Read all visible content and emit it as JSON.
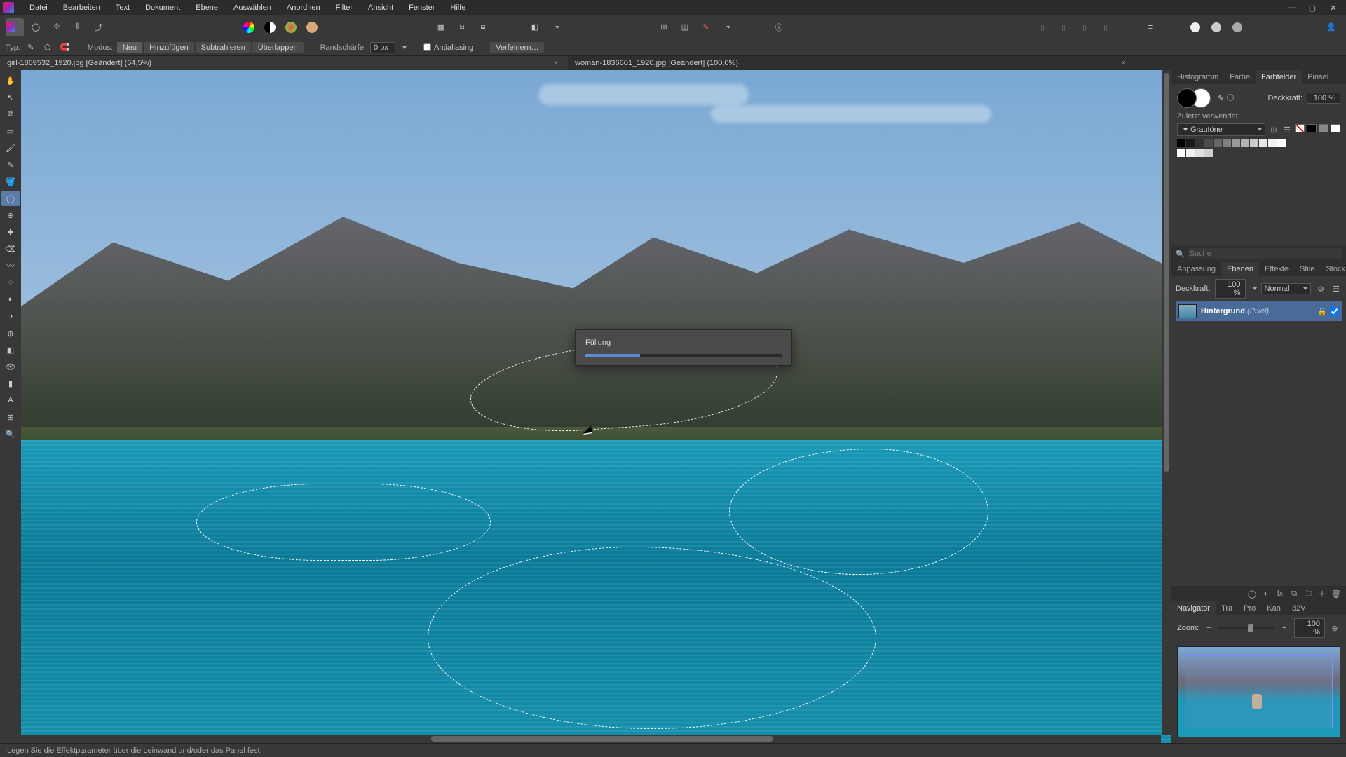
{
  "menu": [
    "Datei",
    "Bearbeiten",
    "Text",
    "Dokument",
    "Ebene",
    "Auswählen",
    "Anordnen",
    "Filter",
    "Ansicht",
    "Fenster",
    "Hilfe"
  ],
  "context": {
    "typ_label": "Typ:",
    "modus_label": "Modus:",
    "modes": [
      "Neu",
      "Hinzufügen",
      "Subtrahieren",
      "Überlappen"
    ],
    "feather_label": "Randschärfe:",
    "feather_value": "0 px",
    "antialias_label": "Antialiasing",
    "refine_label": "Verfeinern…"
  },
  "tabs": [
    {
      "label": "girl-1869532_1920.jpg [Geändert] (64,5%)",
      "active": true
    },
    {
      "label": "woman-1836601_1920.jpg [Geändert] (100,0%)",
      "active": false
    }
  ],
  "dialog": {
    "title": "Füllung",
    "progress_pct": 28
  },
  "right": {
    "top_tabs": [
      "Histogramm",
      "Farbe",
      "Farbfelder",
      "Pinsel"
    ],
    "top_active": "Farbfelder",
    "opacity_label": "Deckkraft:",
    "opacity_value": "100 %",
    "recent_label": "Zuletzt verwendet:",
    "gradient_name": "Grautöne",
    "search_placeholder": "Suche",
    "mid_tabs": [
      "Anpassung",
      "Ebenen",
      "Effekte",
      "Stile",
      "Stock"
    ],
    "mid_active": "Ebenen",
    "layer_opacity_label": "Deckkraft:",
    "layer_opacity_value": "100 %",
    "blend_mode": "Normal",
    "layer_name": "Hintergrund",
    "layer_type": "(Pixel)",
    "nav_tabs": [
      "Navigator",
      "Tra",
      "Pro",
      "Kan",
      "32V"
    ],
    "nav_active": "Navigator",
    "zoom_label": "Zoom:",
    "zoom_value": "100 %"
  },
  "status": "Legen Sie die Effektparameter über die Leinwand und/oder das Panel fest.",
  "grays": [
    "#000",
    "#1a1a1a",
    "#333",
    "#4d4d4d",
    "#666",
    "#808080",
    "#999",
    "#b3b3b3",
    "#ccc",
    "#e6e6e6",
    "#f2f2f2",
    "#fff"
  ],
  "recent_sw": [
    "#fff",
    "#f0f0f0",
    "#e0e0e0",
    "#d0d0d0"
  ],
  "tools": [
    "hand",
    "move",
    "crop",
    "view",
    "brush",
    "pen",
    "fill",
    "ellipse",
    "clone",
    "heal",
    "erase",
    "smudge",
    "blur",
    "dodge",
    "burn",
    "sponge",
    "patch",
    "redfix",
    "shape",
    "text",
    "grid",
    "zoom"
  ]
}
